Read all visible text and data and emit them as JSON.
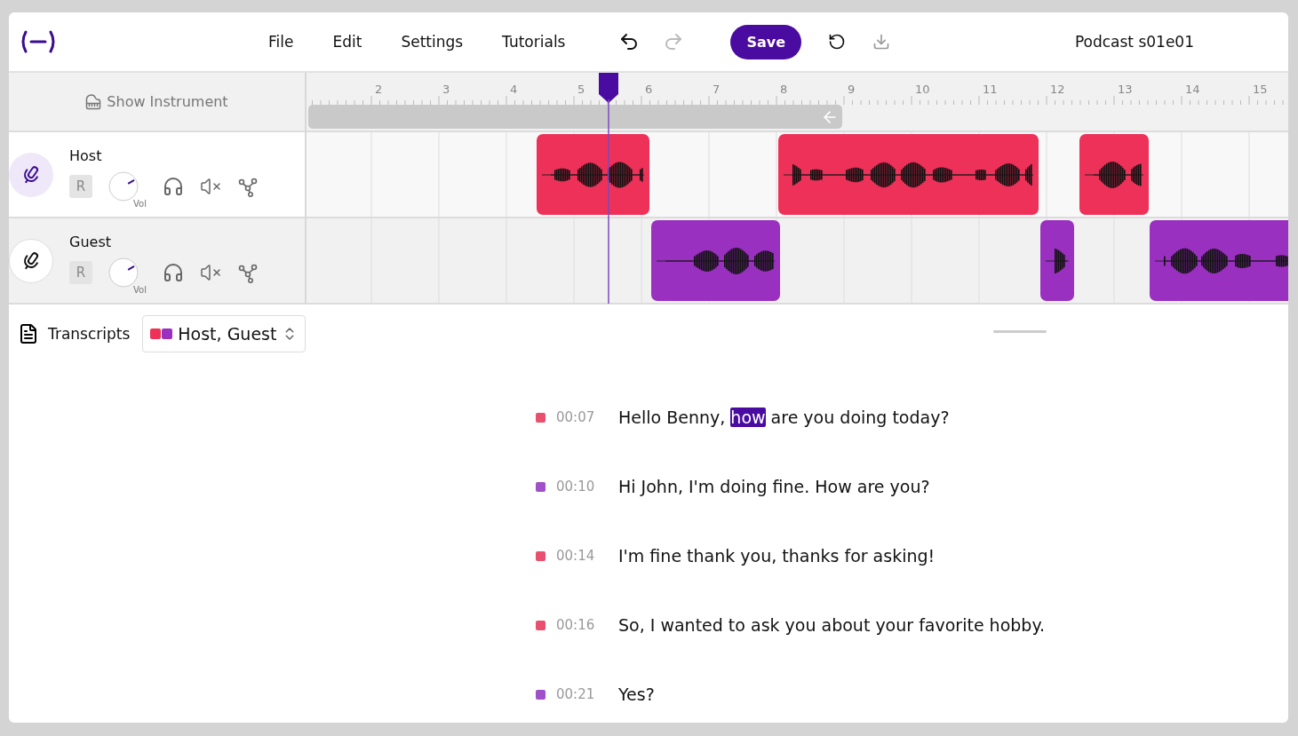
{
  "menu": [
    "File",
    "Edit",
    "Settings",
    "Tutorials"
  ],
  "toolbar": {
    "undo_disabled": false,
    "redo_disabled": true,
    "save": "Save"
  },
  "project_title": "Podcast s01e01",
  "show_instrument": "Show Instrument",
  "ruler": [
    "2",
    "3",
    "4",
    "5",
    "6",
    "7",
    "8",
    "9",
    "10",
    "11",
    "12",
    "13",
    "14",
    "15"
  ],
  "tracks": [
    {
      "name": "Host",
      "color": "#ee3158",
      "selected": true,
      "record": "R",
      "volume": {
        "label": "Vol"
      }
    },
    {
      "name": "Guest",
      "color": "#9a30c0",
      "selected": false,
      "record": "R",
      "volume": {
        "label": "Vol"
      }
    }
  ],
  "transcripts": {
    "label": "Transcripts",
    "filter": "Host, Guest",
    "lines": [
      {
        "time": "00:07",
        "color": "#e8506e",
        "parts": [
          {
            "text": "Hello Benny, ",
            "selected": false
          },
          {
            "text": "how",
            "selected": true
          },
          {
            "text": " are you doing today?",
            "selected": false
          }
        ]
      },
      {
        "time": "00:10",
        "color": "#a050c8",
        "parts": [
          {
            "text": "Hi John, I'm doing fine. How are you?",
            "selected": false
          }
        ]
      },
      {
        "time": "00:14",
        "color": "#e8506e",
        "parts": [
          {
            "text": "I'm fine thank you, thanks for asking!",
            "selected": false
          }
        ]
      },
      {
        "time": "00:16",
        "color": "#e8506e",
        "parts": [
          {
            "text": "So, I wanted to ask you about your favorite hobby.",
            "selected": false
          }
        ]
      },
      {
        "time": "00:21",
        "color": "#a050c8",
        "parts": [
          {
            "text": "Yes?",
            "selected": false
          }
        ]
      }
    ]
  }
}
